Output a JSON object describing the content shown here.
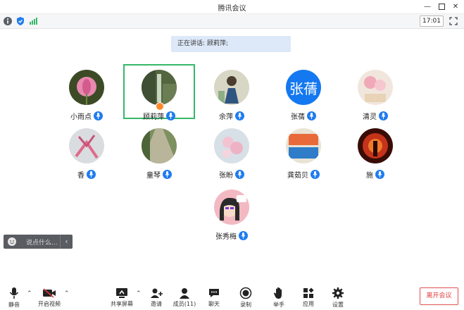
{
  "window": {
    "title": "腾讯会议"
  },
  "topbar": {
    "time": "17:01"
  },
  "speaking": {
    "text": "正在讲话: 顾莉萍;"
  },
  "participants": [
    {
      "name": "小雨点"
    },
    {
      "name": "顾莉萍",
      "active": true,
      "host": true
    },
    {
      "name": "余萍"
    },
    {
      "name": "张蒨",
      "avatar_text": "张蒨"
    },
    {
      "name": "清灵"
    },
    {
      "name": "香"
    },
    {
      "name": "童琴"
    },
    {
      "name": "张盼"
    },
    {
      "name": "龚茹贝"
    },
    {
      "name": "施"
    },
    {
      "name": "张秀梅"
    }
  ],
  "chat": {
    "placeholder": "说点什么..."
  },
  "toolbar": {
    "mute": "静音",
    "video": "开启视频",
    "share": "共享屏幕",
    "invite": "邀请",
    "members": "成员(11)",
    "chat": "聊天",
    "record": "录制",
    "raise": "举手",
    "apps": "应用",
    "settings": "设置",
    "leave": "离开会议"
  },
  "colors": {
    "accent": "#1f7cf0",
    "active_border": "#35b86a",
    "leave": "#e03c3c"
  },
  "icons": [
    "info-icon",
    "shield-icon",
    "signal-icon",
    "fullscreen-icon",
    "mic-icon",
    "camera-off-icon",
    "share-screen-icon",
    "invite-icon",
    "members-icon",
    "chat-icon",
    "record-icon",
    "raise-hand-icon",
    "apps-icon",
    "settings-icon"
  ]
}
